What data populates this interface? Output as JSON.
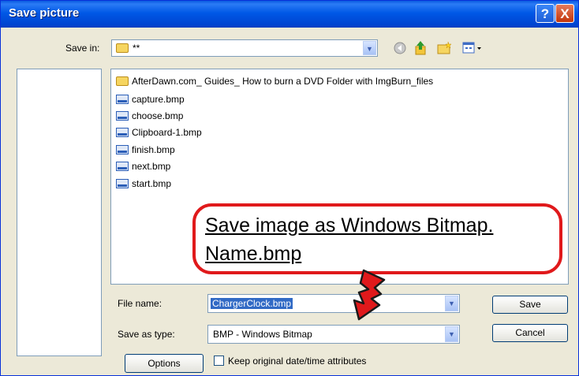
{
  "window": {
    "title": "Save picture"
  },
  "titlebar": {
    "help_glyph": "?",
    "close_glyph": "X"
  },
  "save_in": {
    "label": "Save in:",
    "value": "**"
  },
  "files": [
    {
      "name": "AfterDawn.com_ Guides_ How to burn a DVD Folder with ImgBurn_files",
      "icon": "folder-icon"
    },
    {
      "name": "capture.bmp",
      "icon": "bmp-file-icon"
    },
    {
      "name": "choose.bmp",
      "icon": "bmp-file-icon"
    },
    {
      "name": "Clipboard-1.bmp",
      "icon": "bmp-file-icon"
    },
    {
      "name": "finish.bmp",
      "icon": "bmp-file-icon"
    },
    {
      "name": "next.bmp",
      "icon": "bmp-file-icon"
    },
    {
      "name": "start.bmp",
      "icon": "bmp-file-icon"
    }
  ],
  "annotation": {
    "line1": "Save image as Windows Bitmap.",
    "line2": "Name.bmp",
    "color": "#e0191b"
  },
  "file_name": {
    "label": "File name:",
    "value": "ChargerClock.bmp"
  },
  "save_as_type": {
    "label": "Save as type:",
    "value": "BMP - Windows Bitmap"
  },
  "buttons": {
    "save": "Save",
    "cancel": "Cancel",
    "options": "Options"
  },
  "keep_attributes": {
    "label": "Keep original date/time attributes",
    "checked": false
  }
}
